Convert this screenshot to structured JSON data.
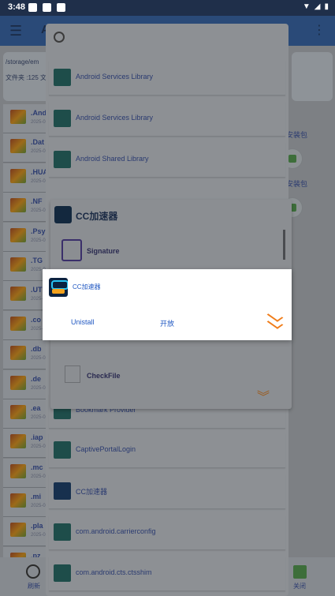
{
  "status_bar": {
    "time": "3:48"
  },
  "app_bar": {
    "title": "A"
  },
  "path_card": {
    "path": "/storage/em",
    "info": "文件夹 :125   文"
  },
  "files": [
    {
      "name": ".And",
      "date": "2025-0"
    },
    {
      "name": ".Dat",
      "date": "2025-0"
    },
    {
      "name": ".HUA",
      "date": "2025-0"
    },
    {
      "name": ".NF",
      "date": "2025-0"
    },
    {
      "name": ".Psy",
      "date": "2025-0"
    },
    {
      "name": ".TG",
      "date": "2025-0"
    },
    {
      "name": ".UT",
      "date": "2025-0"
    },
    {
      "name": ".co",
      "date": "2025-0"
    },
    {
      "name": ".db",
      "date": "2025-0"
    },
    {
      "name": ".de",
      "date": "2025-0"
    },
    {
      "name": ".ea",
      "date": "2025-0"
    },
    {
      "name": ".iap",
      "date": "2025-0"
    },
    {
      "name": ".mc",
      "date": "2025-0"
    },
    {
      "name": ".mi",
      "date": "2025-0"
    },
    {
      "name": ".pla",
      "date": "2025-0"
    },
    {
      "name": ".pz",
      "date": "2025-0"
    }
  ],
  "side_labels": {
    "label1": "安装包",
    "label2": "安装包"
  },
  "bottom_bar": {
    "refresh_label": "刷新",
    "close_label": "关闭"
  },
  "app_list": [
    {
      "name": "Android Services Library",
      "icon": "android-icon"
    },
    {
      "name": "Android Services Library",
      "icon": "android-icon"
    },
    {
      "name": "Android Shared Library",
      "icon": "android-icon"
    },
    {
      "name": "Bookmark Provider",
      "icon": "bookmark-icon"
    },
    {
      "name": "CaptivePortalLogin",
      "icon": "android-icon"
    },
    {
      "name": "CC加速器",
      "icon": "cc-icon"
    },
    {
      "name": "com.android.carrierconfig",
      "icon": "android-icon"
    },
    {
      "name": "com.android.cts.ctsshim",
      "icon": "android-icon"
    }
  ],
  "menu_card": {
    "title": "CC加速器",
    "item_signature": "Signature",
    "item_checkfile": "CheckFile"
  },
  "dialog": {
    "title": "CC加速器",
    "uninstall_label": "Unistall",
    "open_label": "开放"
  }
}
